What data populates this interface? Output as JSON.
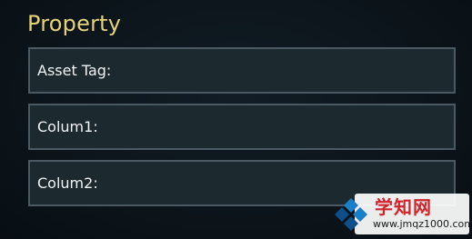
{
  "section": {
    "title": "Property"
  },
  "fields": [
    {
      "label": "Asset Tag:",
      "value": ""
    },
    {
      "label": "Colum1:",
      "value": ""
    },
    {
      "label": "Colum2:",
      "value": ""
    }
  ],
  "watermark": {
    "title": "学知网",
    "url": "www.jmqz1000.com",
    "logo_icon": "blue-cross-logo-icon",
    "colors": {
      "title": "#d2232a",
      "logo_blue": "#1a7fc6",
      "logo_dark": "#0d4f86"
    }
  },
  "colors": {
    "background": "#0c141b",
    "title": "#e6d27a",
    "field_bg": "#1c2a30",
    "field_border": "#4b5a62",
    "field_text": "#f1f3f4"
  }
}
